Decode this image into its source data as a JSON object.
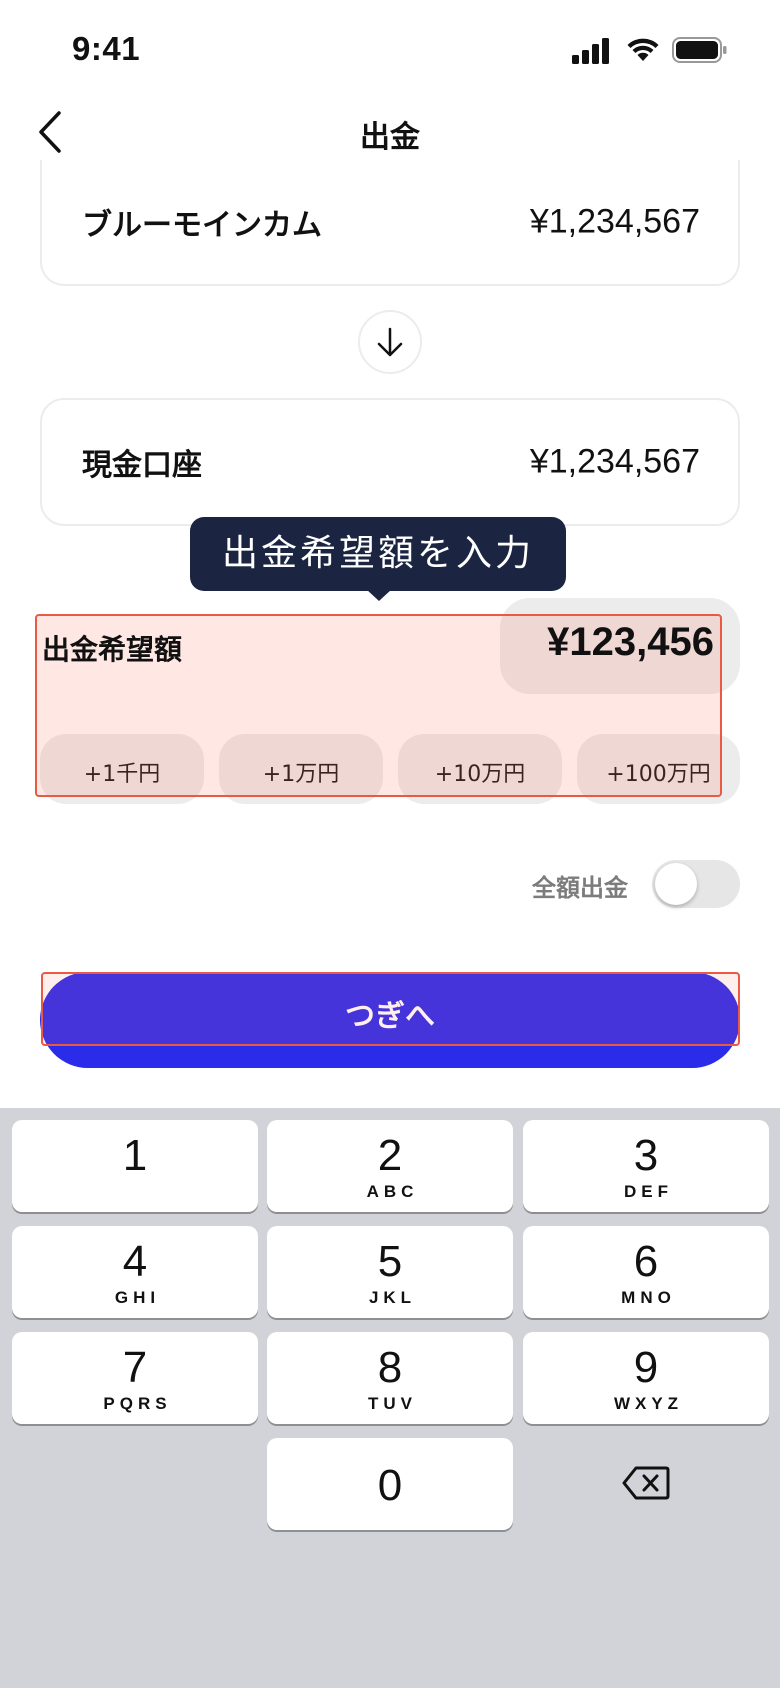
{
  "status_bar": {
    "time": "9:41"
  },
  "nav": {
    "title": "出金"
  },
  "from_account": {
    "label": "ブルーモインカム",
    "amount": "¥1,234,567"
  },
  "to_account": {
    "label": "現金口座",
    "amount": "¥1,234,567"
  },
  "tooltip": {
    "text": "出金希望額を入力"
  },
  "amount_input": {
    "label": "出金希望額",
    "value": "¥123,456"
  },
  "quick_add": [
    "+1千円",
    "+1万円",
    "+10万円",
    "+100万円"
  ],
  "full_withdraw": {
    "label": "全額出金",
    "enabled": false
  },
  "next_button": {
    "label": "つぎへ"
  },
  "keyboard": {
    "keys": [
      {
        "num": "1",
        "letters": ""
      },
      {
        "num": "2",
        "letters": "ABC"
      },
      {
        "num": "3",
        "letters": "DEF"
      },
      {
        "num": "4",
        "letters": "GHI"
      },
      {
        "num": "5",
        "letters": "JKL"
      },
      {
        "num": "6",
        "letters": "MNO"
      },
      {
        "num": "7",
        "letters": "PQRS"
      },
      {
        "num": "8",
        "letters": "TUV"
      },
      {
        "num": "9",
        "letters": "WXYZ"
      },
      {
        "num": "0",
        "letters": ""
      }
    ]
  },
  "colors": {
    "primary": "#2b2bea",
    "tooltip_bg": "#1b2541",
    "highlight": "#e85a44"
  }
}
